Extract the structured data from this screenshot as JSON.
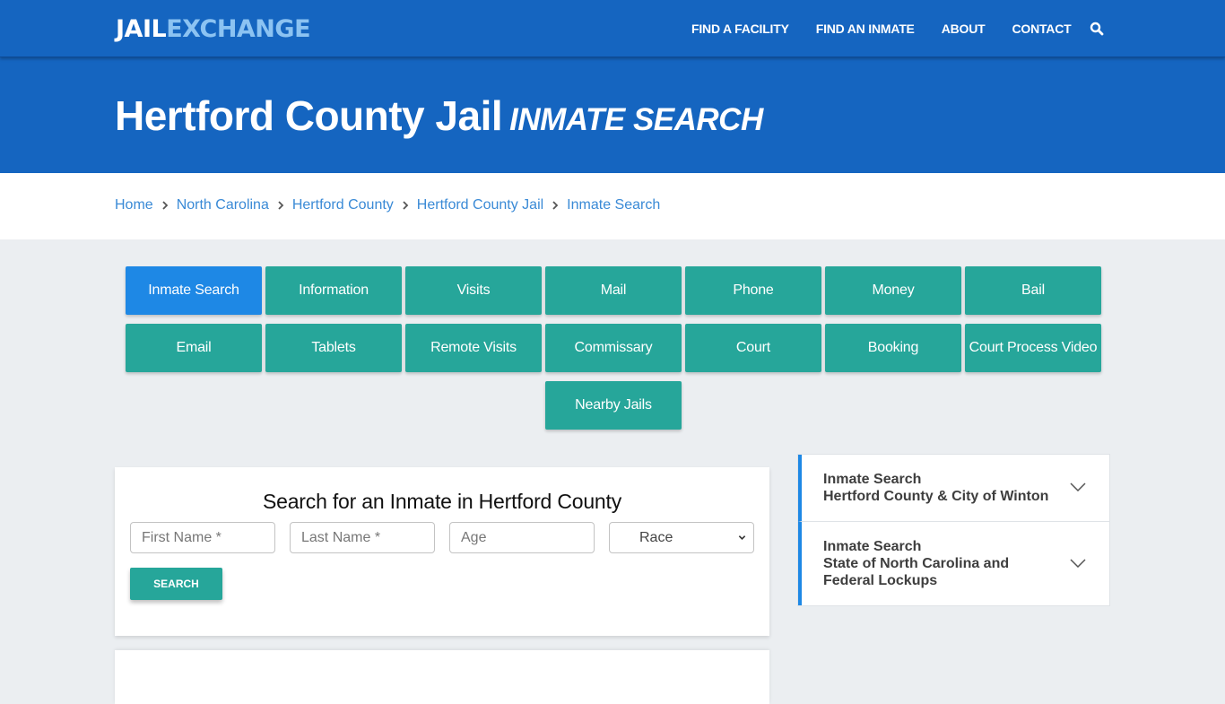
{
  "brand": {
    "logo_part1": "JAIL",
    "logo_part2": "EXCHANGE"
  },
  "nav": {
    "items": [
      {
        "label": "FIND A FACILITY"
      },
      {
        "label": "FIND AN INMATE"
      },
      {
        "label": "ABOUT"
      },
      {
        "label": "CONTACT"
      }
    ],
    "search_icon": "search-icon"
  },
  "hero": {
    "title": "Hertford County Jail",
    "subtitle": "INMATE SEARCH"
  },
  "breadcrumb": [
    {
      "label": "Home"
    },
    {
      "label": "North Carolina"
    },
    {
      "label": "Hertford County"
    },
    {
      "label": "Hertford County Jail"
    },
    {
      "label": "Inmate Search"
    }
  ],
  "tabs": [
    {
      "label": "Inmate Search",
      "active": true
    },
    {
      "label": "Information"
    },
    {
      "label": "Visits"
    },
    {
      "label": "Mail"
    },
    {
      "label": "Phone"
    },
    {
      "label": "Money"
    },
    {
      "label": "Bail"
    },
    {
      "label": "Email"
    },
    {
      "label": "Tablets"
    },
    {
      "label": "Remote Visits"
    },
    {
      "label": "Commissary"
    },
    {
      "label": "Court"
    },
    {
      "label": "Booking"
    },
    {
      "label": "Court Process Video"
    },
    {
      "label": "Nearby Jails"
    }
  ],
  "search_form": {
    "heading": "Search for an Inmate in Hertford County",
    "first_name_placeholder": "First Name *",
    "last_name_placeholder": "Last Name *",
    "age_placeholder": "Age",
    "race_selected": "Race",
    "submit_label": "SEARCH"
  },
  "sidebar": {
    "items": [
      {
        "line1": "Inmate Search",
        "line2": "Hertford County & City of Winton"
      },
      {
        "line1": "Inmate Search",
        "line2": "State of North Carolina and Federal Lockups"
      }
    ]
  },
  "colors": {
    "primary_blue": "#1565c0",
    "logo_accent": "#8cc3f2",
    "tab_teal": "#26a69a",
    "tab_active": "#1e88e5",
    "link_blue": "#3a8ad6"
  }
}
